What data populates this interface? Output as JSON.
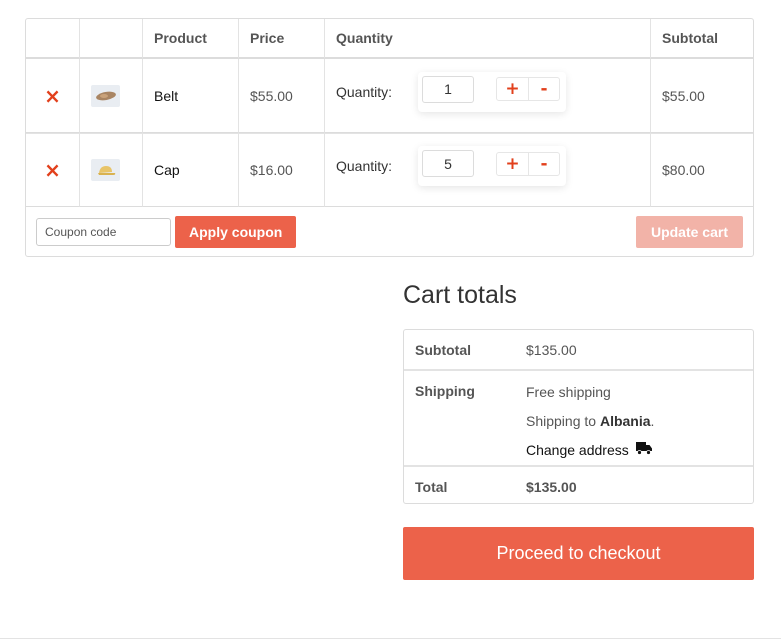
{
  "cart": {
    "headers": {
      "product": "Product",
      "price": "Price",
      "quantity": "Quantity",
      "subtotal": "Subtotal"
    },
    "remove_icon": "×",
    "items": [
      {
        "name": "Belt",
        "price": "$55.00",
        "qty_label": "Quantity:",
        "qty": "1",
        "plus": "+",
        "minus": "-",
        "subtotal": "$55.00",
        "thumb_icon": "belt-thumbnail"
      },
      {
        "name": "Cap",
        "price": "$16.00",
        "qty_label": "Quantity:",
        "qty": "5",
        "plus": "+",
        "minus": "-",
        "subtotal": "$80.00",
        "thumb_icon": "cap-thumbnail"
      }
    ],
    "coupon_placeholder": "Coupon code",
    "apply_coupon": "Apply coupon",
    "update_cart": "Update cart"
  },
  "totals": {
    "title": "Cart totals",
    "subtotal_label": "Subtotal",
    "subtotal_value": "$135.00",
    "shipping_label": "Shipping",
    "shipping_method": "Free shipping",
    "shipping_to_prefix": "Shipping to",
    "shipping_country": "Albania",
    "shipping_to_suffix": ".",
    "change_address": "Change address",
    "total_label": "Total",
    "total_value": "$135.00"
  },
  "checkout": {
    "label": "Proceed to checkout"
  },
  "colors": {
    "accent": "#ec624a",
    "accent_disabled": "#f2b3a8",
    "remove": "#e2401c"
  }
}
